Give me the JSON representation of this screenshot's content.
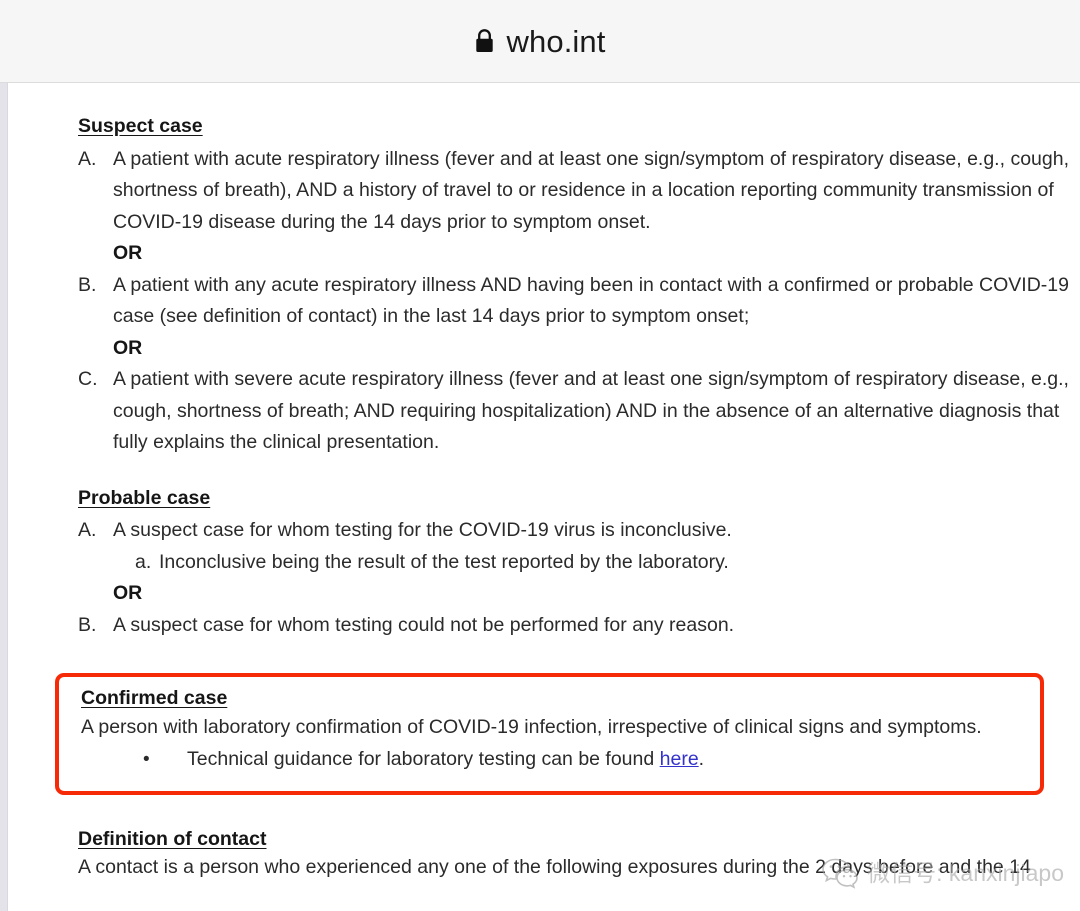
{
  "browser": {
    "lock_icon": "lock-icon",
    "url": "who.int"
  },
  "document": {
    "suspect_case": {
      "heading": "Suspect case",
      "items": [
        {
          "marker": "A.",
          "lines": [
            "A patient with acute respiratory illness (fever and at least one sign/symptom of respiratory disease, e.g., cough,",
            "shortness of breath), AND a history of travel to or residence in a location reporting community transmission of",
            "COVID-19 disease during the 14 days prior to symptom onset."
          ],
          "connector": "OR"
        },
        {
          "marker": "B.",
          "lines": [
            "A patient with any acute respiratory illness AND having been in contact with a confirmed or probable COVID-19",
            "case (see definition of contact) in the last 14 days prior to symptom onset;"
          ],
          "connector": "OR"
        },
        {
          "marker": "C.",
          "lines": [
            "A patient with severe acute respiratory illness (fever and at least one sign/symptom of respiratory disease, e.g.,",
            "cough, shortness of breath; AND requiring hospitalization) AND in the absence of an alternative diagnosis that",
            "fully explains the clinical presentation."
          ],
          "connector": ""
        }
      ]
    },
    "probable_case": {
      "heading": "Probable case",
      "items": [
        {
          "marker": "A.",
          "lines": [
            "A suspect case for whom testing for the COVID-19 virus is inconclusive."
          ],
          "subitem": {
            "marker": "a.",
            "text": "Inconclusive being the result of the test reported by the laboratory."
          },
          "connector": "OR"
        },
        {
          "marker": "B.",
          "lines": [
            "A suspect case for whom testing could not be performed for any reason."
          ],
          "connector": ""
        }
      ]
    },
    "confirmed_case": {
      "heading": "Confirmed case",
      "description": "A person with laboratory confirmation of COVID-19 infection, irrespective of clinical signs and symptoms.",
      "bullet_marker": "•",
      "bullet_text_before": "Technical guidance for laboratory testing can be found ",
      "bullet_link_text": "here",
      "bullet_text_after": ".",
      "highlight_color": "#f72a08",
      "link_color": "#3333cc"
    },
    "definition_of_contact": {
      "heading": "Definition of contact",
      "line": "A contact is a person who experienced any one of the following exposures during the 2 days before and the 14"
    }
  },
  "watermark": {
    "logo_icon": "wechat-logo-icon",
    "text": "微信号: kanxinjiapo"
  }
}
